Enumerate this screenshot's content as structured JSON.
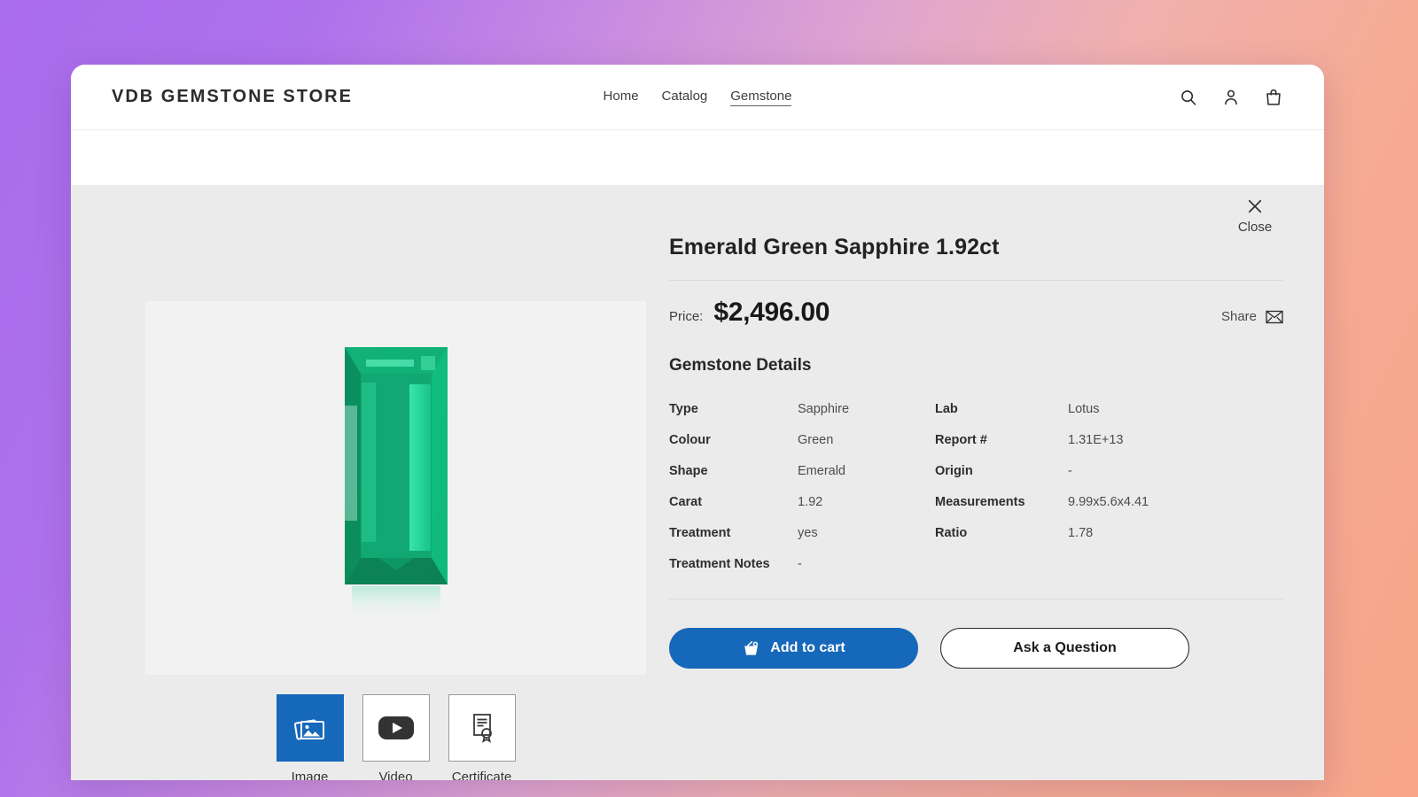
{
  "header": {
    "brand": "VDB GEMSTONE STORE",
    "nav": [
      {
        "label": "Home",
        "active": false
      },
      {
        "label": "Catalog",
        "active": false
      },
      {
        "label": "Gemstone",
        "active": true
      }
    ],
    "icons": [
      {
        "name": "search-icon"
      },
      {
        "name": "account-icon"
      },
      {
        "name": "cart-icon"
      }
    ]
  },
  "quickview": {
    "close_label": "Close",
    "title": "Emerald Green Sapphire 1.92ct",
    "price_label": "Price:",
    "price_value": "$2,496.00",
    "share_label": "Share",
    "details_heading": "Gemstone Details",
    "specs_left": [
      {
        "key": "Type",
        "value": "Sapphire"
      },
      {
        "key": "Colour",
        "value": "Green"
      },
      {
        "key": "Shape",
        "value": "Emerald"
      },
      {
        "key": "Carat",
        "value": "1.92"
      },
      {
        "key": "Treatment",
        "value": "yes"
      },
      {
        "key": "Treatment Notes",
        "value": "-"
      }
    ],
    "specs_right": [
      {
        "key": "Lab",
        "value": "Lotus"
      },
      {
        "key": "Report #",
        "value": "1.31E+13"
      },
      {
        "key": "Origin",
        "value": "-"
      },
      {
        "key": "Measurements",
        "value": "9.99x5.6x4.41"
      },
      {
        "key": "Ratio",
        "value": "1.78"
      },
      {
        "key": "",
        "value": ""
      }
    ],
    "add_to_cart_label": "Add to cart",
    "ask_question_label": "Ask a Question",
    "thumbnails": [
      {
        "label": "Image",
        "icon": "photos-icon",
        "selected": true
      },
      {
        "label": "Video",
        "icon": "play-icon",
        "selected": false
      },
      {
        "label": "Certificate",
        "icon": "certificate-icon",
        "selected": false
      }
    ],
    "gem_alt": "emerald-cut green sapphire"
  },
  "colors": {
    "accent_blue": "#1668ba",
    "panel_bg": "#ebebeb",
    "image_bg": "#f2f2f2",
    "gem_green": "#13a06a",
    "bg_purple": "#a96ceb",
    "bg_salmon": "#f7a489"
  }
}
